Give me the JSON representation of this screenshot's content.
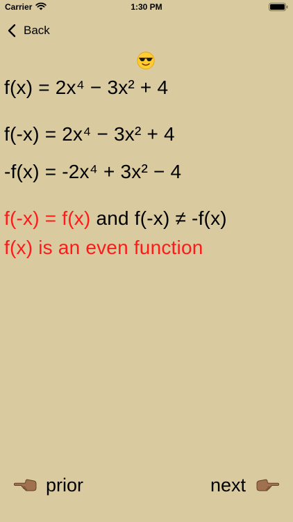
{
  "status_bar": {
    "carrier": "Carrier",
    "time": "1:30 PM"
  },
  "nav": {
    "back_label": "Back"
  },
  "icons": {
    "emoji": "smiling-face-with-sunglasses-icon",
    "prior_hand": "backhand-index-pointing-left-icon",
    "next_hand": "backhand-index-pointing-right-icon"
  },
  "content": {
    "line1": "f(x) = 2x⁴ − 3x² + 4",
    "line2": "f(-x) = 2x⁴ − 3x² + 4",
    "line3": "-f(x) = -2x⁴ + 3x² − 4",
    "line4_red": "f(-x) = f(x)",
    "line4_black": " and f(-x) ≠ -f(x)",
    "line5": "f(x) is an even function"
  },
  "footer": {
    "prior_label": "prior",
    "next_label": "next"
  },
  "colors": {
    "background": "#d9caa0",
    "highlight": "#ff1a1a",
    "text": "#000000"
  }
}
